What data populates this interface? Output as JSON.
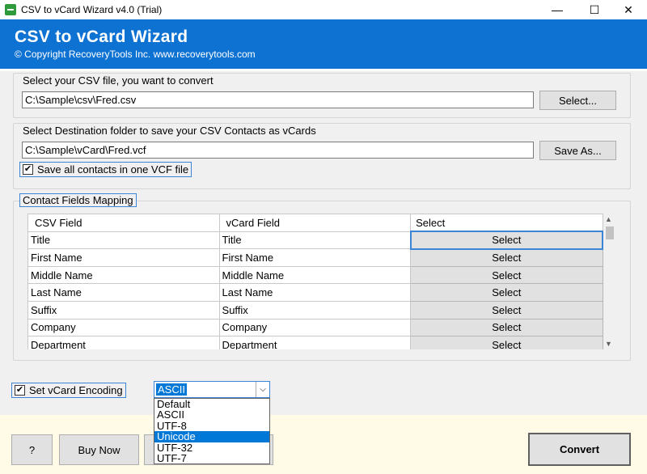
{
  "window": {
    "title": "CSV to vCard Wizard v4.0 (Trial)",
    "controls": [
      "—",
      "☐",
      "✕"
    ]
  },
  "banner": {
    "title": "CSV to vCard Wizard",
    "subtitle": "© Copyright RecoveryTools Inc. www.recoverytools.com"
  },
  "source": {
    "label": "Select your CSV file, you want to convert",
    "path": "C:\\Sample\\csv\\Fred.csv",
    "button": "Select..."
  },
  "destination": {
    "label": "Select Destination folder to save your CSV Contacts as vCards",
    "path": "C:\\Sample\\vCard\\Fred.vcf",
    "button": "Save As...",
    "single_file_label": "Save all contacts in one VCF file",
    "single_file_checked": true
  },
  "mapping": {
    "legend": "Contact Fields Mapping",
    "columns": [
      "CSV Field",
      "vCard Field",
      "Select"
    ],
    "rows": [
      {
        "csv": "Title",
        "vcard": "Title",
        "action": "Select"
      },
      {
        "csv": "First Name",
        "vcard": "First Name",
        "action": "Select"
      },
      {
        "csv": "Middle Name",
        "vcard": "Middle Name",
        "action": "Select"
      },
      {
        "csv": "Last Name",
        "vcard": "Last Name",
        "action": "Select"
      },
      {
        "csv": "Suffix",
        "vcard": "Suffix",
        "action": "Select"
      },
      {
        "csv": "Company",
        "vcard": "Company",
        "action": "Select"
      },
      {
        "csv": "Department",
        "vcard": "Department",
        "action": "Select"
      }
    ]
  },
  "encoding": {
    "label": "Set vCard Encoding",
    "checked": true,
    "selected": "ASCII",
    "options": [
      "Default",
      "ASCII",
      "UTF-8",
      "Unicode",
      "UTF-32",
      "UTF-7"
    ],
    "highlighted": "Unicode"
  },
  "footer": {
    "help": "?",
    "buy": "Buy Now",
    "convert": "Convert"
  }
}
